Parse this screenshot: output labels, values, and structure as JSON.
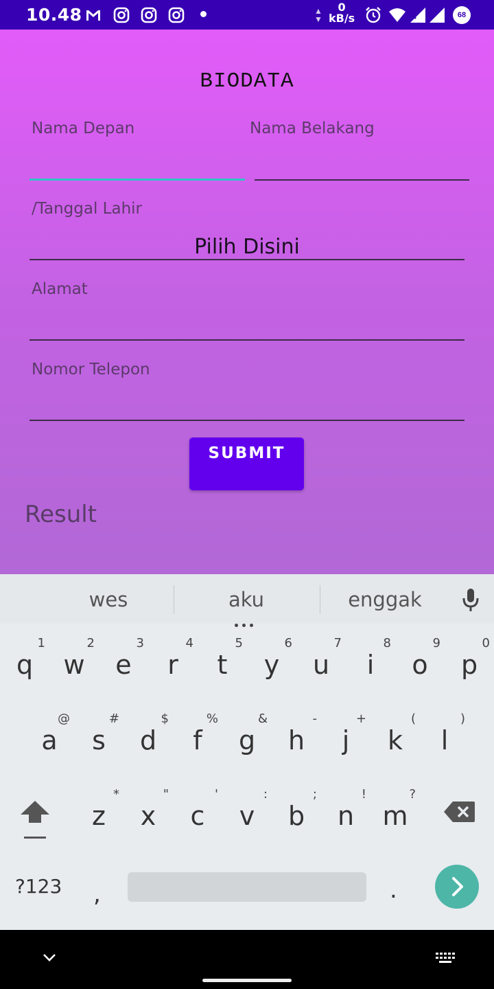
{
  "status_bar": {
    "time": "10.48",
    "speed_value": "0",
    "speed_unit": "kB/s",
    "battery": "68",
    "icons": [
      "gmail-icon",
      "instagram-icon",
      "instagram-icon",
      "instagram-icon",
      "notification-dot",
      "alarm-icon",
      "wifi-icon",
      "signal-icon",
      "battery-icon"
    ]
  },
  "app": {
    "title": "BIODATA",
    "first_name_label": "Nama Depan",
    "last_name_label": "Nama Belakang",
    "birthdate_label": "/Tanggal Lahir",
    "birthdate_value": "Pilih Disini",
    "address_label": "Alamat",
    "phone_label": "Nomor Telepon",
    "submit_label": "SUBMIT",
    "result_label": "Result"
  },
  "keyboard": {
    "suggestions": [
      "wes",
      "aku",
      "enggak"
    ],
    "row1": [
      {
        "key": "q",
        "hint": "1"
      },
      {
        "key": "w",
        "hint": "2"
      },
      {
        "key": "e",
        "hint": "3"
      },
      {
        "key": "r",
        "hint": "4"
      },
      {
        "key": "t",
        "hint": "5"
      },
      {
        "key": "y",
        "hint": "6"
      },
      {
        "key": "u",
        "hint": "7"
      },
      {
        "key": "i",
        "hint": "8"
      },
      {
        "key": "o",
        "hint": "9"
      },
      {
        "key": "p",
        "hint": "0"
      }
    ],
    "row2": [
      {
        "key": "a",
        "hint": "@"
      },
      {
        "key": "s",
        "hint": "#"
      },
      {
        "key": "d",
        "hint": "$"
      },
      {
        "key": "f",
        "hint": "%"
      },
      {
        "key": "g",
        "hint": "&"
      },
      {
        "key": "h",
        "hint": "-"
      },
      {
        "key": "j",
        "hint": "+"
      },
      {
        "key": "k",
        "hint": "("
      },
      {
        "key": "l",
        "hint": ")"
      }
    ],
    "row3": [
      {
        "key": "z",
        "hint": "*"
      },
      {
        "key": "x",
        "hint": "\""
      },
      {
        "key": "c",
        "hint": "'"
      },
      {
        "key": "v",
        "hint": ":"
      },
      {
        "key": "b",
        "hint": ";"
      },
      {
        "key": "n",
        "hint": "!"
      },
      {
        "key": "m",
        "hint": "?"
      }
    ],
    "symbols_label": "?123",
    "comma_label": ",",
    "period_label": "."
  },
  "colors": {
    "status_bar": "#3700b3",
    "gradient_top": "#e25cf9",
    "gradient_bottom": "#b268d6",
    "submit_button": "#6200ee",
    "focus_underline": "#2ec4c8",
    "enter_button": "#4db6a7"
  }
}
